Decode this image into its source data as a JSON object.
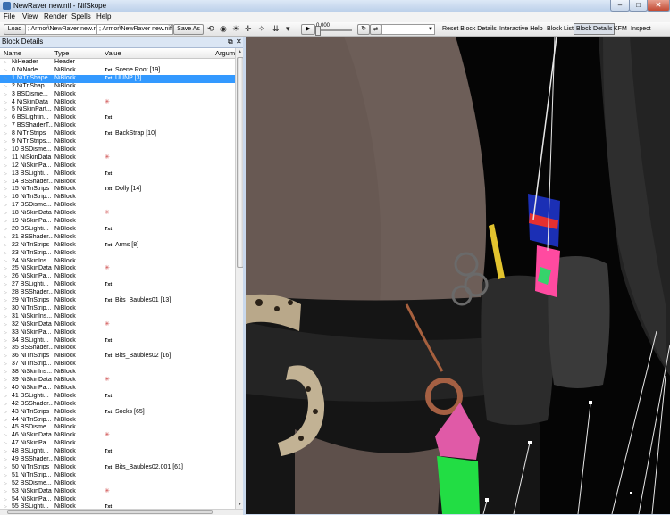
{
  "window": {
    "title": "NewRaver new.nif - NifSkope",
    "min": "–",
    "max": "□",
    "close": "✕"
  },
  "menu": [
    "File",
    "View",
    "Render",
    "Spells",
    "Help"
  ],
  "toolbar": {
    "load_label": "Load",
    "load_path": "; Armor\\NewRaver new.nif",
    "save_path": "; Armor\\NewRaver new.nif",
    "save_as_label": "Save As",
    "time_value": "0.000",
    "icons": [
      "rotate-icon",
      "eye-icon",
      "sun-icon",
      "axes-icon",
      "arrow-down-icon",
      "chevron-down-icon",
      "play-icon",
      "loop-icon"
    ],
    "actions": [
      "Reset Block Details",
      "Interactive Help",
      "Block List",
      "Block Details",
      "KFM",
      "Inspect"
    ]
  },
  "block_panel": {
    "title": "Block Details",
    "float_icon": "restore-icon",
    "close_icon": "close-icon",
    "columns": [
      "Name",
      "Type",
      "Value",
      "Argum"
    ],
    "rows": [
      {
        "name": "NiHeader",
        "type": "Header",
        "icon": "",
        "value": ""
      },
      {
        "name": "0 NiNode",
        "type": "NiBlock",
        "icon": "Txt",
        "value": "Scene Root [19]"
      },
      {
        "name": "1 NiTriShape",
        "type": "NiBlock",
        "icon": "Txt",
        "value": "UUNP [3]"
      },
      {
        "name": "2 NiTriShap...",
        "type": "NiBlock",
        "icon": "",
        "value": ""
      },
      {
        "name": "3 BSDisme...",
        "type": "NiBlock",
        "icon": "",
        "value": ""
      },
      {
        "name": "4 NiSkinData",
        "type": "NiBlock",
        "icon": "pin",
        "value": ""
      },
      {
        "name": "5 NiSkinPart...",
        "type": "NiBlock",
        "icon": "",
        "value": ""
      },
      {
        "name": "6 BSLightin...",
        "type": "NiBlock",
        "icon": "Txt",
        "value": ""
      },
      {
        "name": "7 BSShaderT...",
        "type": "NiBlock",
        "icon": "",
        "value": ""
      },
      {
        "name": "8 NiTriStrips",
        "type": "NiBlock",
        "icon": "Txt",
        "value": "BackStrap [10]"
      },
      {
        "name": "9 NiTriStrips...",
        "type": "NiBlock",
        "icon": "",
        "value": ""
      },
      {
        "name": "10 BSDisme...",
        "type": "NiBlock",
        "icon": "",
        "value": ""
      },
      {
        "name": "11 NiSkinData",
        "type": "NiBlock",
        "icon": "pin",
        "value": ""
      },
      {
        "name": "12 NiSkinPa...",
        "type": "NiBlock",
        "icon": "",
        "value": ""
      },
      {
        "name": "13 BSLighti...",
        "type": "NiBlock",
        "icon": "Txt",
        "value": ""
      },
      {
        "name": "14 BSShader...",
        "type": "NiBlock",
        "icon": "",
        "value": ""
      },
      {
        "name": "15 NiTriStrips",
        "type": "NiBlock",
        "icon": "Txt",
        "value": "Dolly [14]"
      },
      {
        "name": "16 NiTriStrip...",
        "type": "NiBlock",
        "icon": "",
        "value": ""
      },
      {
        "name": "17 BSDisme...",
        "type": "NiBlock",
        "icon": "",
        "value": ""
      },
      {
        "name": "18 NiSkinData",
        "type": "NiBlock",
        "icon": "pin",
        "value": ""
      },
      {
        "name": "19 NiSkinPa...",
        "type": "NiBlock",
        "icon": "",
        "value": ""
      },
      {
        "name": "20 BSLighti...",
        "type": "NiBlock",
        "icon": "Txt",
        "value": ""
      },
      {
        "name": "21 BSShader...",
        "type": "NiBlock",
        "icon": "",
        "value": ""
      },
      {
        "name": "22 NiTriStrips",
        "type": "NiBlock",
        "icon": "Txt",
        "value": "Arms [8]"
      },
      {
        "name": "23 NiTriStrip...",
        "type": "NiBlock",
        "icon": "",
        "value": ""
      },
      {
        "name": "24 NiSkinIns...",
        "type": "NiBlock",
        "icon": "",
        "value": ""
      },
      {
        "name": "25 NiSkinData",
        "type": "NiBlock",
        "icon": "pin",
        "value": ""
      },
      {
        "name": "26 NiSkinPa...",
        "type": "NiBlock",
        "icon": "",
        "value": ""
      },
      {
        "name": "27 BSLighti...",
        "type": "NiBlock",
        "icon": "Txt",
        "value": ""
      },
      {
        "name": "28 BSShader...",
        "type": "NiBlock",
        "icon": "",
        "value": ""
      },
      {
        "name": "29 NiTriStrips",
        "type": "NiBlock",
        "icon": "Txt",
        "value": "Bits_Baubles01 [13]"
      },
      {
        "name": "30 NiTriStrip...",
        "type": "NiBlock",
        "icon": "",
        "value": ""
      },
      {
        "name": "31 NiSkinIns...",
        "type": "NiBlock",
        "icon": "",
        "value": ""
      },
      {
        "name": "32 NiSkinData",
        "type": "NiBlock",
        "icon": "pin",
        "value": ""
      },
      {
        "name": "33 NiSkinPa...",
        "type": "NiBlock",
        "icon": "",
        "value": ""
      },
      {
        "name": "34 BSLighti...",
        "type": "NiBlock",
        "icon": "Txt",
        "value": ""
      },
      {
        "name": "35 BSShader...",
        "type": "NiBlock",
        "icon": "",
        "value": ""
      },
      {
        "name": "36 NiTriStrips",
        "type": "NiBlock",
        "icon": "Txt",
        "value": "Bits_Baubles02 [16]"
      },
      {
        "name": "37 NiTriStrip...",
        "type": "NiBlock",
        "icon": "",
        "value": ""
      },
      {
        "name": "38 NiSkinIns...",
        "type": "NiBlock",
        "icon": "",
        "value": ""
      },
      {
        "name": "39 NiSkinData",
        "type": "NiBlock",
        "icon": "pin",
        "value": ""
      },
      {
        "name": "40 NiSkinPa...",
        "type": "NiBlock",
        "icon": "",
        "value": ""
      },
      {
        "name": "41 BSLighti...",
        "type": "NiBlock",
        "icon": "Txt",
        "value": ""
      },
      {
        "name": "42 BSShader...",
        "type": "NiBlock",
        "icon": "",
        "value": ""
      },
      {
        "name": "43 NiTriStrips",
        "type": "NiBlock",
        "icon": "Txt",
        "value": "Socks [65]"
      },
      {
        "name": "44 NiTriStrip...",
        "type": "NiBlock",
        "icon": "",
        "value": ""
      },
      {
        "name": "45 BSDisme...",
        "type": "NiBlock",
        "icon": "",
        "value": ""
      },
      {
        "name": "46 NiSkinData",
        "type": "NiBlock",
        "icon": "pin",
        "value": ""
      },
      {
        "name": "47 NiSkinPa...",
        "type": "NiBlock",
        "icon": "",
        "value": ""
      },
      {
        "name": "48 BSLighti...",
        "type": "NiBlock",
        "icon": "Txt",
        "value": ""
      },
      {
        "name": "49 BSShader...",
        "type": "NiBlock",
        "icon": "",
        "value": ""
      },
      {
        "name": "50 NiTriStrips",
        "type": "NiBlock",
        "icon": "Txt",
        "value": "Bits_Baubles02.001 [61]"
      },
      {
        "name": "51 NiTriStrip...",
        "type": "NiBlock",
        "icon": "",
        "value": ""
      },
      {
        "name": "52 BSDisme...",
        "type": "NiBlock",
        "icon": "",
        "value": ""
      },
      {
        "name": "53 NiSkinData",
        "type": "NiBlock",
        "icon": "pin",
        "value": ""
      },
      {
        "name": "54 NiSkinPa...",
        "type": "NiBlock",
        "icon": "",
        "value": ""
      },
      {
        "name": "55 BSLighti...",
        "type": "NiBlock",
        "icon": "Txt",
        "value": ""
      }
    ],
    "selected_index": 2
  },
  "colors": {
    "selection": "#3399ff",
    "skin": "#6f5f58",
    "fabric": "#1b1b1b",
    "pink": "#e05aa7",
    "green": "#22dd44",
    "rust": "#9a5a3a"
  }
}
